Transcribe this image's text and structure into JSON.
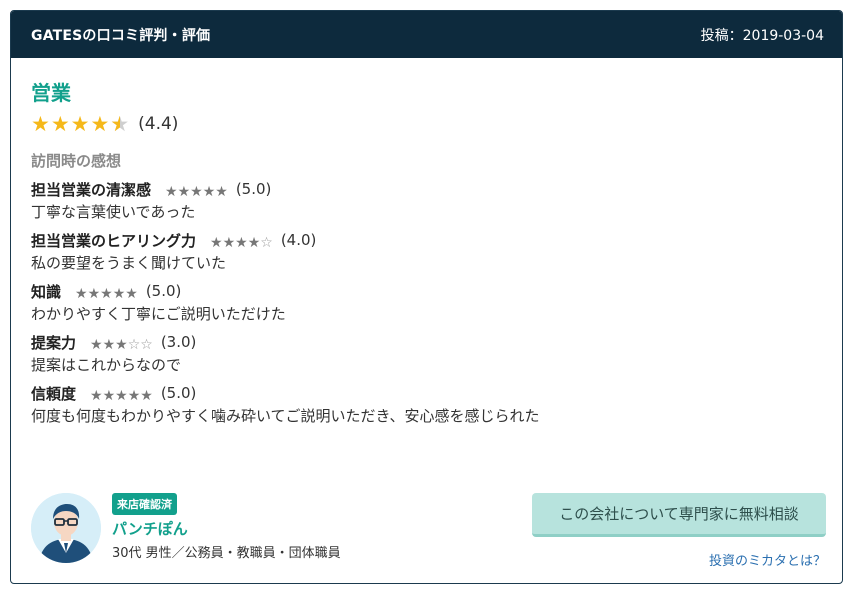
{
  "header": {
    "title": "GATESの口コミ評判・評価",
    "date": "投稿：2019-03-04"
  },
  "review": {
    "category": "営業",
    "overall_score": "(4.4)",
    "overall_value": 4.4,
    "section_label": "訪問時の感想",
    "items": [
      {
        "label": "担当営業の清潔感",
        "value": 5,
        "score": "(5.0)",
        "comment": "丁寧な言葉使いであった"
      },
      {
        "label": "担当営業のヒアリング力",
        "value": 4,
        "score": "(4.0)",
        "comment": "私の要望をうまく聞けていた"
      },
      {
        "label": "知識",
        "value": 5,
        "score": "(5.0)",
        "comment": "わかりやすく丁寧にご説明いただけた"
      },
      {
        "label": "提案力",
        "value": 3,
        "score": "(3.0)",
        "comment": "提案はこれからなので"
      },
      {
        "label": "信頼度",
        "value": 5,
        "score": "(5.0)",
        "comment": "何度も何度もわかりやすく噛み砕いてご説明いただき、安心感を感じられた"
      }
    ]
  },
  "user": {
    "badge": "来店確認済",
    "name": "パンチぽん",
    "info": "30代 男性／公務員・教職員・団体職員",
    "avatar_icon": "person-avatar-icon"
  },
  "actions": {
    "consult_label": "この会社について専門家に無料相談",
    "about_link": "投資のミカタとは？"
  },
  "colors": {
    "header_bg": "#0d2a3d",
    "accent": "#12a08c",
    "star_gold": "#f5b81a",
    "star_gray": "#777777",
    "button_bg": "#b7e3dd",
    "link": "#2a6fb0"
  }
}
